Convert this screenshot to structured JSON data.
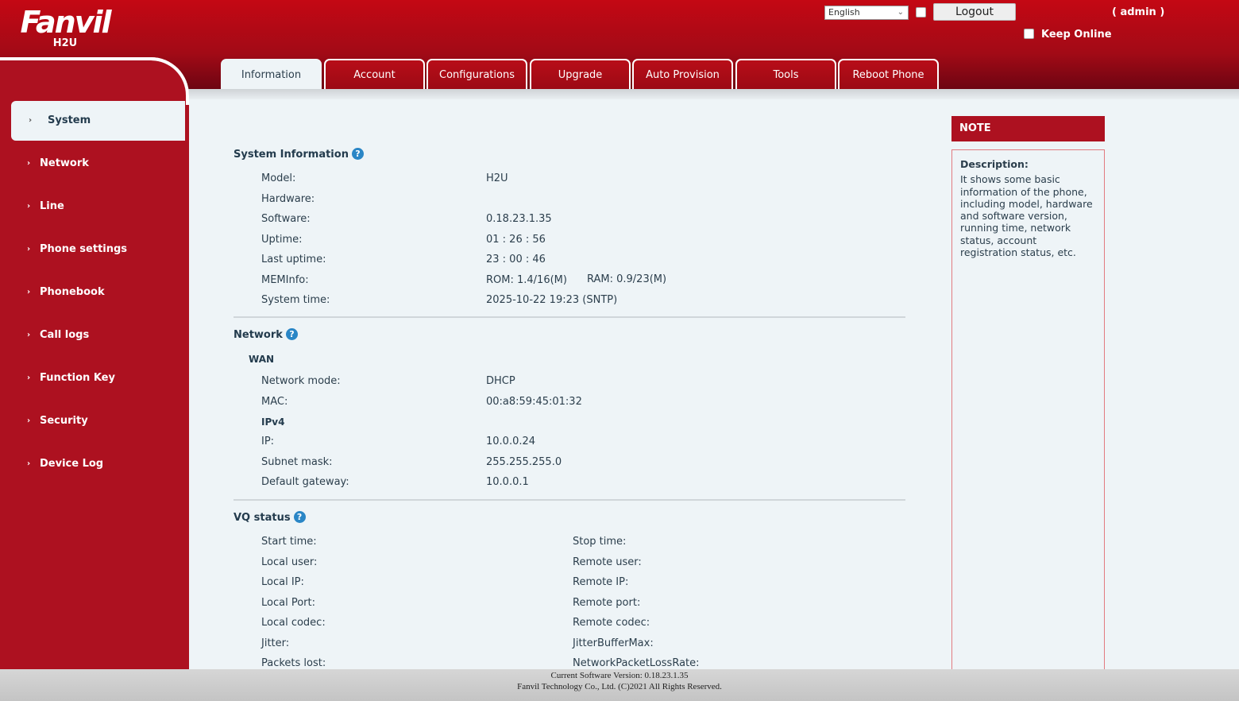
{
  "header": {
    "brand": "Fanvil",
    "model": "H2U",
    "language": "English",
    "logout": "Logout",
    "user": "( admin )",
    "keep_online": "Keep Online"
  },
  "tabs": [
    "Information",
    "Account",
    "Configurations",
    "Upgrade",
    "Auto Provision",
    "Tools",
    "Reboot Phone"
  ],
  "sidebar": [
    "System",
    "Network",
    "Line",
    "Phone settings",
    "Phonebook",
    "Call logs",
    "Function Key",
    "Security",
    "Device Log"
  ],
  "system_info": {
    "title": "System Information",
    "rows": [
      [
        "Model:",
        "H2U"
      ],
      [
        "Hardware:",
        ""
      ],
      [
        "Software:",
        "0.18.23.1.35"
      ],
      [
        "Uptime:",
        "01 : 26 : 56"
      ],
      [
        "Last uptime:",
        "23 : 00 : 46"
      ],
      [
        "MEMInfo:",
        "ROM: 1.4/16(M)"
      ],
      [
        "System time:",
        "2025-10-22 19:23 (SNTP)"
      ]
    ],
    "ram": "RAM: 0.9/23(M)"
  },
  "network": {
    "title": "Network",
    "wan": "WAN",
    "rows1": [
      [
        "Network mode:",
        "DHCP"
      ],
      [
        "MAC:",
        "00:a8:59:45:01:32"
      ]
    ],
    "ipv4": "IPv4",
    "rows2": [
      [
        "IP:",
        "10.0.0.24"
      ],
      [
        "Subnet mask:",
        "255.255.255.0"
      ],
      [
        "Default gateway:",
        "10.0.0.1"
      ]
    ]
  },
  "vq": {
    "title": "VQ status",
    "left": [
      "Start time:",
      "Local user:",
      "Local IP:",
      "Local Port:",
      "Local codec:",
      "Jitter:",
      "Packets lost:"
    ],
    "right": [
      "Stop time:",
      "Remote user:",
      "Remote IP:",
      "Remote port:",
      "Remote codec:",
      "JitterBufferMax:",
      "NetworkPacketLossRate:"
    ]
  },
  "note": {
    "title": "NOTE",
    "heading": "Description:",
    "text": "It shows some basic information of the phone, including model, hardware and software version, running time, network status, account registration status, etc."
  },
  "footer": {
    "version": "Current Software Version: 0.18.23.1.35",
    "copyright": "Fanvil Technology Co., Ltd. (C)2021 All Rights Reserved."
  },
  "colors": {
    "brand_red": "#ad1120",
    "help_blue": "#2a86c6"
  }
}
